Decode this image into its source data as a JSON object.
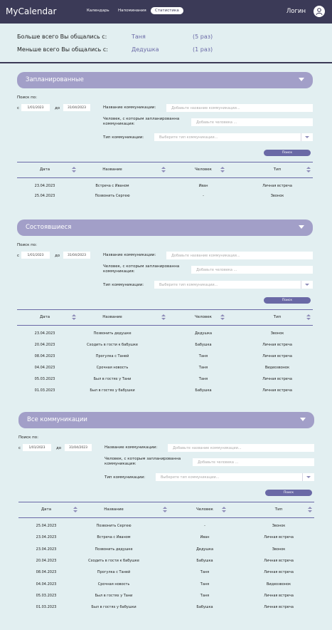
{
  "header": {
    "logo": "MyCalendar",
    "nav": [
      "Календарь",
      "Напоминания",
      "Статистика"
    ],
    "active_nav": "Статистика",
    "login": "Логин"
  },
  "stats": {
    "most_label": "Больше всего Вы общались с:",
    "most_name": "Таня",
    "most_count": "(5 раз)",
    "least_label": "Меньше всего Вы общались с:",
    "least_name": "Дедушка",
    "least_count": "(1 раз)"
  },
  "filters": {
    "search_by": "Поиск по:",
    "from": "с",
    "to": "до",
    "date_from": "1/01/2023",
    "date_to": "31/04/2023",
    "name_label": "Название коммуникации:",
    "name_placeholder": "Добавьте название коммуникации...",
    "person_label": "Человек, с которым запланированна коммуникация:",
    "person_placeholder": "Добавьте человека ...",
    "type_label": "Тип коммуникации:",
    "type_placeholder": "Выберите тип коммуникации...",
    "search_button": "Поиск"
  },
  "columns": [
    "Дата",
    "Название",
    "Человек",
    "Тип"
  ],
  "sections": [
    {
      "title": "Запланированные",
      "rows": [
        [
          "23.04.2023",
          "Встреча с Иваном",
          "Иван",
          "Личная встреча"
        ],
        [
          "25.04.2023",
          "Позвонить Сергею",
          "-",
          "Звонок"
        ]
      ]
    },
    {
      "title": "Состоявшиеся",
      "rows": [
        [
          "23.04.2023",
          "Позвонить дедушке",
          "Дедушка",
          "Звонок"
        ],
        [
          "20.04.2023",
          "Сходить в гости к бабушке",
          "Бабушка",
          "Личная встреча"
        ],
        [
          "08.04.2023",
          "Прогулка с Таней",
          "Таня",
          "Личная встреча"
        ],
        [
          "04.04.2023",
          "Срочная новость",
          "Таня",
          "Видеозвонок"
        ],
        [
          "05.03.2023",
          "Был в гостях у Тани",
          "Таня",
          "Личная встреча"
        ],
        [
          "01.03.2023",
          "Был в гостях у бабушки",
          "Бабушка",
          "Личная встреча"
        ]
      ]
    },
    {
      "title": "Все коммуникации",
      "rows": [
        [
          "25.04.2023",
          "Позвонить Сергею",
          "-",
          "Звонок"
        ],
        [
          "23.04.2023",
          "Встреча с Иваном",
          "Иван",
          "Личная встреча"
        ],
        [
          "23.04.2023",
          "Позвонить дедушке",
          "Дедушка",
          "Звонок"
        ],
        [
          "20.04.2023",
          "Сходить в гости к бабушке",
          "Бабушка",
          "Личная встреча"
        ],
        [
          "08.04.2023",
          "Прогулка с Таней",
          "Таня",
          "Личная встреча"
        ],
        [
          "04.04.2023",
          "Срочная новость",
          "Таня",
          "Видеозвонок"
        ],
        [
          "05.03.2023",
          "Был в гостях у Тани",
          "Таня",
          "Личная встреча"
        ],
        [
          "01.03.2023",
          "Был в гостях у бабушки",
          "Бабушка",
          "Личная встреча"
        ]
      ]
    }
  ],
  "colors": {
    "header_bg": "#3b3a57",
    "section_header": "#a29fc8",
    "accent": "#6a69a6",
    "page_bg": "#e2eff1"
  }
}
